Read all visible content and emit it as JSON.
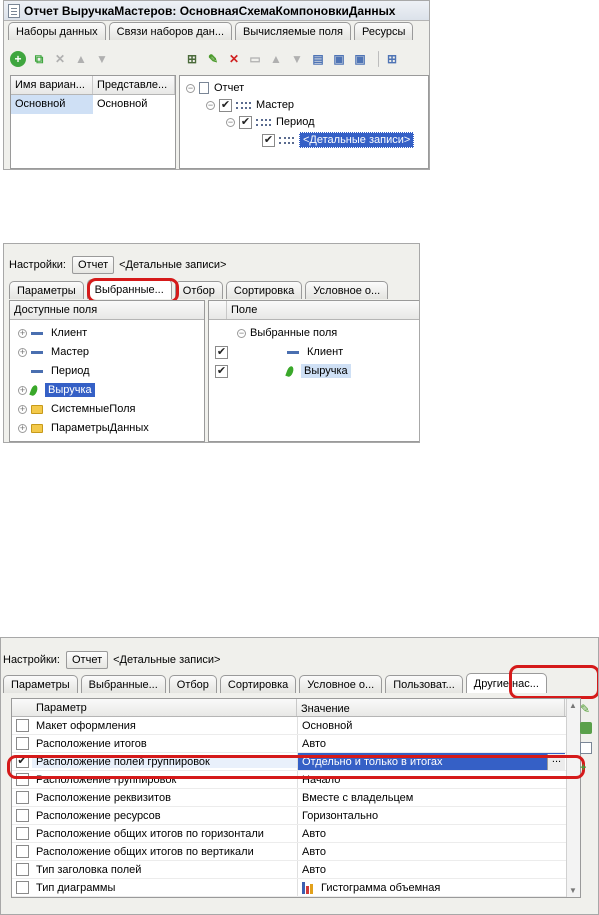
{
  "shot1": {
    "window_title": "Отчет ВыручкаМастеров: ОсновнаяСхемаКомпоновкиДанных",
    "tabs": [
      "Наборы данных",
      "Связи наборов дан...",
      "Вычисляемые поля",
      "Ресурсы"
    ],
    "variants_grid": {
      "headers": [
        "Имя вариан...",
        "Представле..."
      ],
      "rows": [
        [
          "Основной",
          "Основной"
        ]
      ]
    },
    "structure_tree": {
      "root": "Отчет",
      "level1": "Мастер",
      "level2": "Период",
      "level3": "<Детальные записи>"
    }
  },
  "shot2": {
    "settings_label": "Настройки:",
    "settings_button": "Отчет",
    "settings_path": "<Детальные записи>",
    "tabs": [
      "Параметры",
      "Выбранные...",
      "Отбор",
      "Сортировка",
      "Условное о..."
    ],
    "available_fields_header": "Доступные поля",
    "available_fields": [
      "Клиент",
      "Мастер",
      "Период",
      "Выручка",
      "СистемныеПоля",
      "ПараметрыДанных"
    ],
    "selected_header": "Поле",
    "selected_group": "Выбранные поля",
    "selected_fields": [
      "Клиент",
      "Выручка"
    ]
  },
  "shot3": {
    "settings_label": "Настройки:",
    "settings_button": "Отчет",
    "settings_path": "<Детальные записи>",
    "tabs": [
      "Параметры",
      "Выбранные...",
      "Отбор",
      "Сортировка",
      "Условное о...",
      "Пользоват...",
      "Другие нас..."
    ],
    "table_headers": [
      "Параметр",
      "Значение"
    ],
    "rows": [
      {
        "param": "Макет оформления",
        "value": "Основной",
        "checked": false
      },
      {
        "param": "Расположение итогов",
        "value": "Авто",
        "checked": false
      },
      {
        "param": "Расположение полей группировок",
        "value": "Отдельно и только в итогах",
        "checked": true
      },
      {
        "param": "Расположение группировок",
        "value": "Начало",
        "checked": false
      },
      {
        "param": "Расположение реквизитов",
        "value": "Вместе с владельцем",
        "checked": false
      },
      {
        "param": "Расположение ресурсов",
        "value": "Горизонтально",
        "checked": false
      },
      {
        "param": "Расположение общих итогов по горизонтали",
        "value": "Авто",
        "checked": false
      },
      {
        "param": "Расположение общих итогов по вертикали",
        "value": "Авто",
        "checked": false
      },
      {
        "param": "Тип заголовка полей",
        "value": "Авто",
        "checked": false
      },
      {
        "param": "Тип диаграммы",
        "value": "Гистограмма объемная",
        "checked": false
      }
    ],
    "ellipsis": "..."
  },
  "check_mark": "✔",
  "accent_colors": {
    "selection": "#3560c6",
    "highlight_oval": "#d51a1a"
  }
}
